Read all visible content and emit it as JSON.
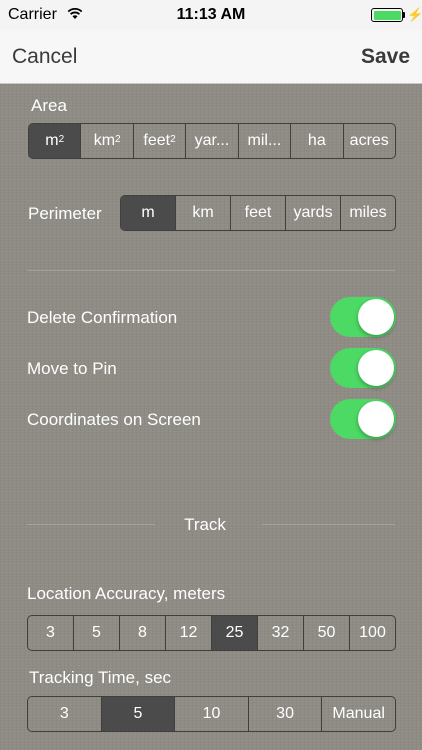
{
  "status_bar": {
    "carrier": "Carrier",
    "time": "11:13 AM",
    "battery_color": "#4cd964"
  },
  "nav": {
    "cancel": "Cancel",
    "save": "Save"
  },
  "area": {
    "label": "Area",
    "options": [
      {
        "base": "m",
        "sup": "2"
      },
      {
        "base": "km",
        "sup": "2"
      },
      {
        "base": "feet",
        "sup": "2"
      },
      {
        "base": "yar...",
        "sup": ""
      },
      {
        "base": "mil...",
        "sup": ""
      },
      {
        "base": "ha",
        "sup": ""
      },
      {
        "base": "acres",
        "sup": ""
      }
    ],
    "selected_index": 0
  },
  "perimeter": {
    "label": "Perimeter",
    "options": [
      "m",
      "km",
      "feet",
      "yards",
      "miles"
    ],
    "selected_index": 0
  },
  "toggles": [
    {
      "label": "Delete Confirmation",
      "on": true
    },
    {
      "label": "Move to Pin",
      "on": true
    },
    {
      "label": "Coordinates on Screen",
      "on": true
    }
  ],
  "track": {
    "title": "Track",
    "accuracy_label": "Location Accuracy, meters",
    "accuracy_options": [
      "3",
      "5",
      "8",
      "12",
      "25",
      "32",
      "50",
      "100"
    ],
    "accuracy_selected_index": 4,
    "time_label": "Tracking Time, sec",
    "time_options": [
      "3",
      "5",
      "10",
      "30",
      "Manual"
    ],
    "time_selected_index": 1
  },
  "colors": {
    "toggle_on": "#4cd964",
    "segment_selected": "#4b4b4b"
  }
}
